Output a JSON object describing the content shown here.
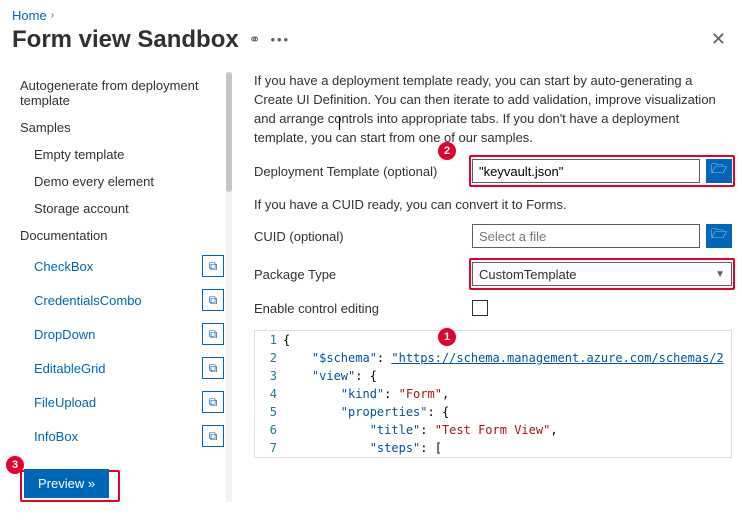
{
  "breadcrumb": {
    "home": "Home"
  },
  "title": "Form view Sandbox",
  "sidebar": {
    "items": [
      {
        "label": "Autogenerate from deployment template"
      },
      {
        "label": "Samples"
      },
      {
        "label": "Empty template"
      },
      {
        "label": "Demo every element"
      },
      {
        "label": "Storage account"
      },
      {
        "label": "Documentation"
      },
      {
        "label": "CheckBox"
      },
      {
        "label": "CredentialsCombo"
      },
      {
        "label": "DropDown"
      },
      {
        "label": "EditableGrid"
      },
      {
        "label": "FileUpload"
      },
      {
        "label": "InfoBox"
      }
    ]
  },
  "main": {
    "intro": "If you have a deployment template ready, you can start by auto-generating a Create UI Definition. You can then iterate to add validation, improve visualization and arrange controls into appropriate tabs. If you don't have a deployment template, you can start from one of our samples.",
    "dep_label": "Deployment Template (optional)",
    "dep_value": "\"keyvault.json\"",
    "cuid_note": "If you have a CUID ready, you can convert it to Forms.",
    "cuid_label": "CUID (optional)",
    "cuid_placeholder": "Select a file",
    "pkg_label": "Package Type",
    "pkg_value": "CustomTemplate",
    "enable_label": "Enable control editing"
  },
  "code": {
    "l1": "{",
    "l2a": "    \"$schema\"",
    "l2b": ": ",
    "l2c": "\"https://schema.management.azure.com/schemas/2",
    "l3a": "    \"view\"",
    "l3b": ": {",
    "l4a": "        \"kind\"",
    "l4b": ": ",
    "l4c": "\"Form\"",
    "l4d": ",",
    "l5a": "        \"properties\"",
    "l5b": ": {",
    "l6a": "            \"title\"",
    "l6b": ": ",
    "l6c": "\"Test Form View\"",
    "l6d": ",",
    "l7a": "            \"steps\"",
    "l7b": ": ["
  },
  "badges": {
    "b1": "1",
    "b2": "2",
    "b3": "3"
  },
  "preview": "Preview »"
}
